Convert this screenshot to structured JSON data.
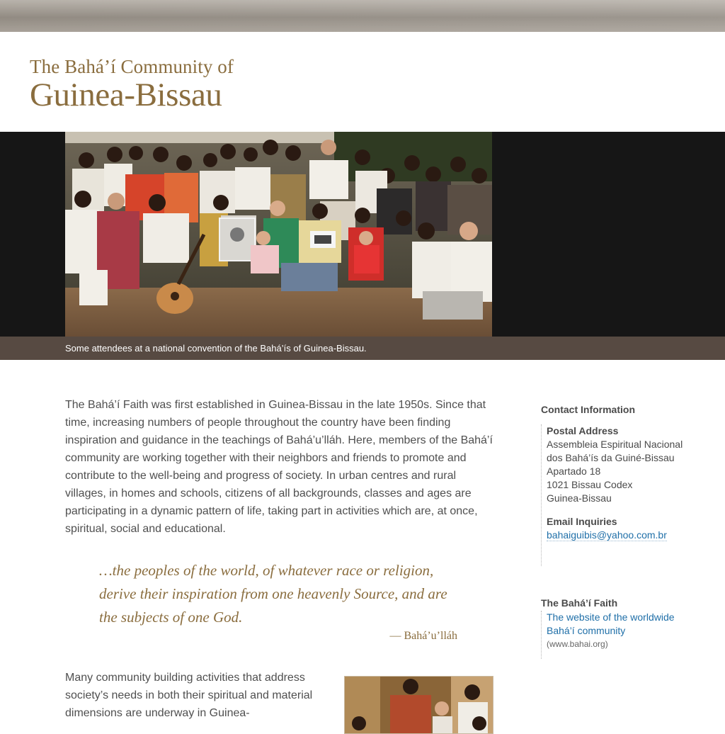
{
  "header": {
    "title_line1": "The Bahá’í Community of",
    "title_line2": "Guinea-Bissau"
  },
  "hero": {
    "caption": "Some attendees at a national convention of the Bahá’ís of Guinea-Bissau."
  },
  "main": {
    "intro": "The Bahá’í Faith was first established in Guinea-Bissau in the late 1950s. Since that time, increasing numbers of people throughout the country have been finding inspiration and guidance in the teachings of Bahá’u’lláh. Here, members of the Bahá’í community are working together with their neighbors and friends to promote and contribute to the well-being and progress of society. In urban centres and rural villages, in homes and schools, citizens of all backgrounds, classes and ages are participating in a dynamic pattern of life, taking part in activities which are, at once, spiritual, social and educational.",
    "quote": "…the peoples of the world, of whatever race or religion, derive their inspiration from one heavenly Source, and are the subjects of one God.",
    "quote_attribution": "— Bahá’u’lláh",
    "paragraph2": "Many community building activities that address society’s needs in both their spiritual and material dimensions are underway in Guinea-"
  },
  "sidebar": {
    "contact_heading": "Contact Information",
    "postal_heading": "Postal Address",
    "address_lines": [
      "Assembleia Espiritual Nacional",
      "dos Bahá’ís da Guiné-Bissau",
      "Apartado 18",
      "1021 Bissau Codex",
      "Guinea-Bissau"
    ],
    "email_heading": "Email Inquiries",
    "email": "bahaiguibis@yahoo.com.br",
    "faith_heading": "The Bahá’í Faith",
    "faith_link_line1": "The website of the worldwide",
    "faith_link_line2": "Bahá’í community",
    "faith_url": "(www.bahai.org)"
  }
}
